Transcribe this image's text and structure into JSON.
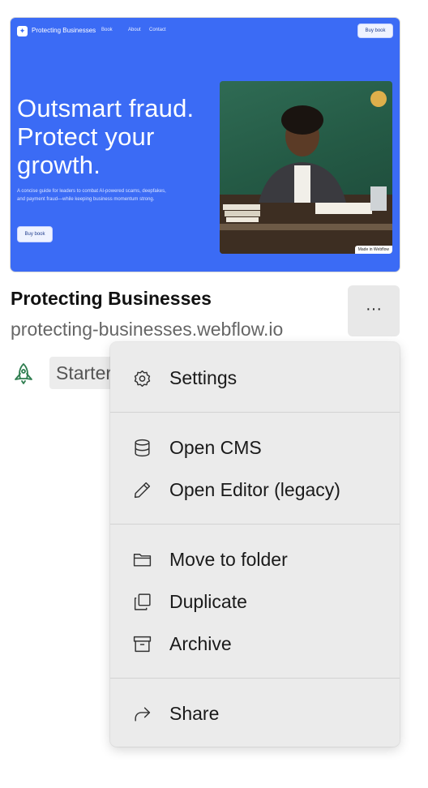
{
  "thumbnail": {
    "brand": "Protecting Businesses",
    "nav_links": [
      "Book",
      "About",
      "Contact"
    ],
    "top_button": "Buy book",
    "headline": "Outsmart fraud. Protect your growth.",
    "subtext": "A concise guide for leaders to combat AI-powered scams, deepfakes, and payment fraud—while keeping business momentum strong.",
    "cta_button": "Buy book",
    "badge": "Made in Webflow"
  },
  "site": {
    "title": "Protecting Businesses",
    "url": "protecting-businesses.webflow.io",
    "status": "Starter",
    "more_label": "···"
  },
  "menu": {
    "items": [
      {
        "label": "Settings",
        "icon": "gear-icon"
      },
      {
        "label": "Open CMS",
        "icon": "database-icon"
      },
      {
        "label": "Open Editor (legacy)",
        "icon": "pencil-icon"
      },
      {
        "label": "Move to folder",
        "icon": "folder-icon"
      },
      {
        "label": "Duplicate",
        "icon": "duplicate-icon"
      },
      {
        "label": "Archive",
        "icon": "archive-icon"
      },
      {
        "label": "Share",
        "icon": "share-icon"
      }
    ]
  },
  "colors": {
    "thumbnail_bg": "#3b6bf5",
    "menu_bg": "#ebebeb",
    "rocket": "#2e7d4f"
  }
}
